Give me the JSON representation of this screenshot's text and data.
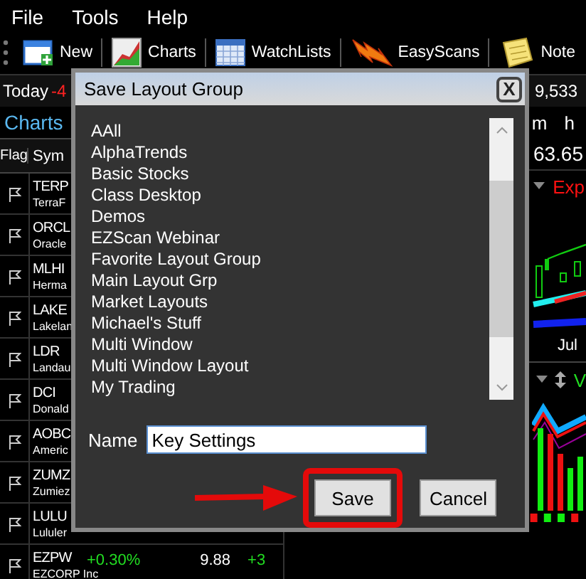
{
  "menu": [
    "File",
    "Tools",
    "Help"
  ],
  "toolbar": [
    {
      "kind": "new",
      "label": "New"
    },
    {
      "kind": "charts",
      "label": "Charts"
    },
    {
      "kind": "watchlists",
      "label": "WatchLists"
    },
    {
      "kind": "easyscans",
      "label": "EasyScans"
    },
    {
      "kind": "notes",
      "label": "Note"
    }
  ],
  "ticker": {
    "label": "Today",
    "change": "-4",
    "value": "9,533"
  },
  "watchlist": {
    "title": "Charts",
    "columns": [
      "Flag",
      "Sym"
    ],
    "rows": [
      {
        "sym": "TERP",
        "name": "TerraF"
      },
      {
        "sym": "ORCL",
        "name": "Oracle"
      },
      {
        "sym": "MLHI",
        "name": "Herma"
      },
      {
        "sym": "LAKE",
        "name": "Lakelan"
      },
      {
        "sym": "LDR",
        "name": "Landau"
      },
      {
        "sym": "DCI",
        "name": "Donald"
      },
      {
        "sym": "AOBC",
        "name": "Americ"
      },
      {
        "sym": "ZUMZ",
        "name": "Zumiez"
      },
      {
        "sym": "LULU",
        "name": "Lululer"
      },
      {
        "sym": "EZPW",
        "name": "EZCORP Inc",
        "change": "+0.30%",
        "price": "9.88",
        "net": "+3"
      }
    ]
  },
  "chart": {
    "timeframes": [
      "m",
      "h"
    ],
    "price": "63.65",
    "study": "Exp",
    "axis_label": "Jul",
    "lower_study": "V"
  },
  "dialog": {
    "title": "Save Layout Group",
    "close": "X",
    "items": [
      "AAll",
      "AlphaTrends",
      "Basic Stocks",
      "Class Desktop",
      "Demos",
      "EZScan Webinar",
      "Favorite Layout Group",
      "Main Layout Grp",
      "Market Layouts",
      "Michael's Stuff",
      "Multi Window",
      "Multi Window Layout",
      "My Trading"
    ],
    "name_label": "Name",
    "name_value": "Key Settings",
    "buttons": [
      {
        "label": "Save",
        "highlighted": true
      },
      {
        "label": "Cancel",
        "highlighted": false
      }
    ]
  }
}
